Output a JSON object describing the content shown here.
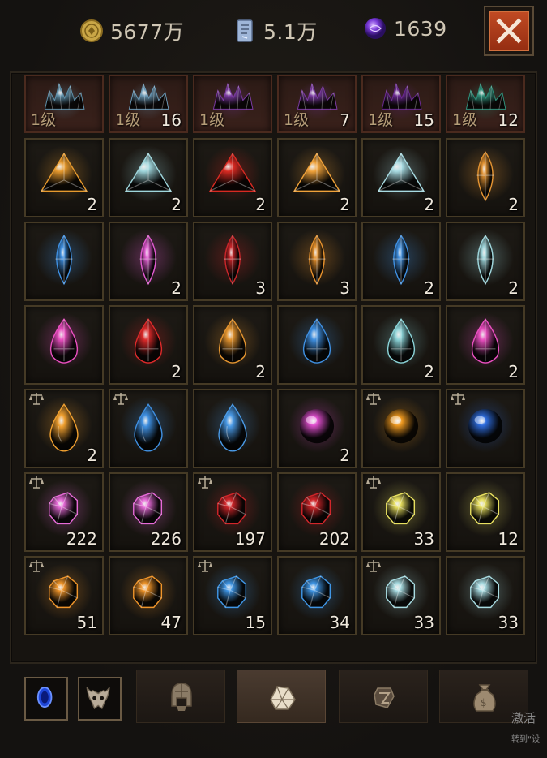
{
  "header": {
    "gold": "5677万",
    "scroll": "5.1万",
    "orb": "1639",
    "gold_icon": "gold-coin-icon",
    "scroll_icon": "scroll-currency-icon",
    "orb_icon": "purple-orb-icon",
    "close_icon": "close-icon"
  },
  "top_row": [
    {
      "level": "1级",
      "count": "",
      "color": "#5f8fa8",
      "icon": "blue-crystal-cluster-icon"
    },
    {
      "level": "1级",
      "count": "16",
      "color": "#6a98b5",
      "icon": "blue-crystal-cluster-icon"
    },
    {
      "level": "1级",
      "count": "",
      "color": "#7a3aa0",
      "icon": "purple-crystal-cluster-icon"
    },
    {
      "level": "1级",
      "count": "7",
      "color": "#7a3aa0",
      "icon": "purple-crystal-cluster-icon"
    },
    {
      "level": "1级",
      "count": "15",
      "color": "#6a2a90",
      "icon": "purple-crystal-cluster-icon"
    },
    {
      "level": "1级",
      "count": "12",
      "color": "#2f8f7a",
      "icon": "teal-crystal-cluster-icon"
    }
  ],
  "rows": [
    [
      {
        "shape": "triangle",
        "color": "#e79a2e",
        "count": "2"
      },
      {
        "shape": "triangle",
        "color": "#9fd6dc",
        "count": "2"
      },
      {
        "shape": "triangle",
        "color": "#d82a22",
        "count": "2"
      },
      {
        "shape": "triangle",
        "color": "#f0a23a",
        "count": "2"
      },
      {
        "shape": "triangle",
        "color": "#a8dbe2",
        "count": "2"
      },
      {
        "shape": "marquise",
        "color": "#e39332",
        "count": "2"
      }
    ],
    [
      {
        "shape": "marquise",
        "color": "#3f8fe0",
        "count": ""
      },
      {
        "shape": "marquise",
        "color": "#e05ad0",
        "count": "2"
      },
      {
        "shape": "marquise",
        "color": "#c8262a",
        "count": "3"
      },
      {
        "shape": "marquise",
        "color": "#e5902c",
        "count": "3"
      },
      {
        "shape": "marquise",
        "color": "#3f8fe0",
        "count": "2"
      },
      {
        "shape": "marquise",
        "color": "#9fd6dc",
        "count": "2"
      }
    ],
    [
      {
        "shape": "pear",
        "color": "#ea4fc0",
        "count": ""
      },
      {
        "shape": "pear",
        "color": "#dd2a2a",
        "count": "2"
      },
      {
        "shape": "pear",
        "color": "#e39430",
        "count": "2"
      },
      {
        "shape": "pear",
        "color": "#3f8fe0",
        "count": ""
      },
      {
        "shape": "pear",
        "color": "#8ad2d6",
        "count": "2"
      },
      {
        "shape": "pear",
        "color": "#ea4fc0",
        "count": "2"
      }
    ],
    [
      {
        "shape": "drop",
        "color": "#f0a030",
        "count": "2",
        "bound": true
      },
      {
        "shape": "drop",
        "color": "#3f8fe0",
        "count": "",
        "bound": true
      },
      {
        "shape": "drop",
        "color": "#4a9ae6",
        "count": "",
        "bound": false
      },
      {
        "shape": "orb",
        "color": "#e24fd0",
        "count": "2",
        "bound": false
      },
      {
        "shape": "orb",
        "color": "#f09a20",
        "count": "",
        "bound": true
      },
      {
        "shape": "orb",
        "color": "#2f6ee0",
        "count": "",
        "bound": true
      }
    ],
    [
      {
        "shape": "rough",
        "color": "#e76ad8",
        "count": "222",
        "bound": true
      },
      {
        "shape": "rough",
        "color": "#e76ad8",
        "count": "226",
        "bound": false
      },
      {
        "shape": "rough",
        "color": "#d2262a",
        "count": "197",
        "bound": true
      },
      {
        "shape": "rough",
        "color": "#d2262a",
        "count": "202",
        "bound": false
      },
      {
        "shape": "rough",
        "color": "#e8e060",
        "count": "33",
        "bound": true
      },
      {
        "shape": "rough",
        "color": "#e8e060",
        "count": "12",
        "bound": false
      }
    ],
    [
      {
        "shape": "rough",
        "color": "#f0952a",
        "count": "51",
        "bound": true
      },
      {
        "shape": "rough",
        "color": "#f0952a",
        "count": "47",
        "bound": false
      },
      {
        "shape": "rough",
        "color": "#3f96e6",
        "count": "15",
        "bound": true
      },
      {
        "shape": "rough",
        "color": "#3f96e6",
        "count": "34",
        "bound": false
      },
      {
        "shape": "rough",
        "color": "#a8dce2",
        "count": "33",
        "bound": true
      },
      {
        "shape": "rough",
        "color": "#a8dce2",
        "count": "33",
        "bound": false
      }
    ]
  ],
  "bottom": {
    "left_buttons": [
      "blue-stone-icon",
      "demon-mask-icon"
    ],
    "tabs": [
      {
        "icon": "helmet-icon",
        "active": false
      },
      {
        "icon": "gem-tab-icon",
        "active": true
      },
      {
        "icon": "rune-tab-icon",
        "active": false
      },
      {
        "icon": "bag-tab-icon",
        "active": false
      }
    ]
  },
  "watermark": {
    "line1": "激活",
    "line2": "转到“设"
  }
}
